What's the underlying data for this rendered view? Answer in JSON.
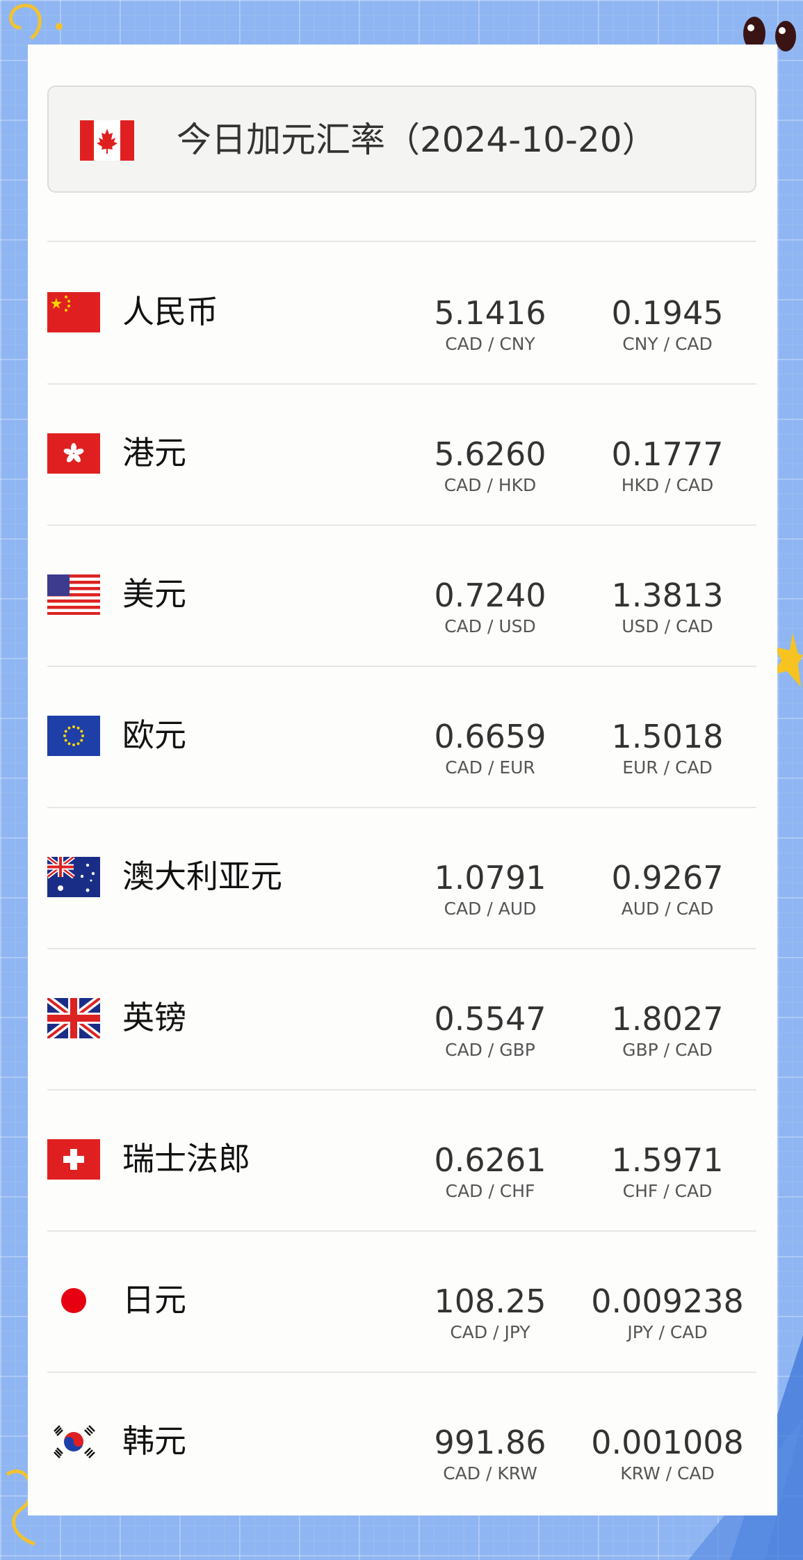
{
  "header": {
    "flag_icon": "canada-flag-icon",
    "title": "今日加元汇率（2024-10-20）"
  },
  "colors": {
    "background": "#8fb6f2",
    "card": "#fdfdfb",
    "flag_red": "#e02020"
  },
  "rates": [
    {
      "flag_icon": "china-flag-icon",
      "name": "人民币",
      "value_a": "5.1416",
      "pair_a": "CAD / CNY",
      "value_b": "0.1945",
      "pair_b": "CNY / CAD"
    },
    {
      "flag_icon": "hong-kong-flag-icon",
      "name": "港元",
      "value_a": "5.6260",
      "pair_a": "CAD / HKD",
      "value_b": "0.1777",
      "pair_b": "HKD / CAD"
    },
    {
      "flag_icon": "usa-flag-icon",
      "name": "美元",
      "value_a": "0.7240",
      "pair_a": "CAD / USD",
      "value_b": "1.3813",
      "pair_b": "USD / CAD"
    },
    {
      "flag_icon": "eu-flag-icon",
      "name": "欧元",
      "value_a": "0.6659",
      "pair_a": "CAD / EUR",
      "value_b": "1.5018",
      "pair_b": "EUR / CAD"
    },
    {
      "flag_icon": "australia-flag-icon",
      "name": "澳大利亚元",
      "value_a": "1.0791",
      "pair_a": "CAD / AUD",
      "value_b": "0.9267",
      "pair_b": "AUD / CAD"
    },
    {
      "flag_icon": "uk-flag-icon",
      "name": "英镑",
      "value_a": "0.5547",
      "pair_a": "CAD / GBP",
      "value_b": "1.8027",
      "pair_b": "GBP / CAD"
    },
    {
      "flag_icon": "switzerland-flag-icon",
      "name": "瑞士法郎",
      "value_a": "0.6261",
      "pair_a": "CAD / CHF",
      "value_b": "1.5971",
      "pair_b": "CHF / CAD"
    },
    {
      "flag_icon": "japan-flag-icon",
      "name": "日元",
      "value_a": "108.25",
      "pair_a": "CAD / JPY",
      "value_b": "0.009238",
      "pair_b": "JPY / CAD"
    },
    {
      "flag_icon": "south-korea-flag-icon",
      "name": "韩元",
      "value_a": "991.86",
      "pair_a": "CAD / KRW",
      "value_b": "0.001008",
      "pair_b": "KRW / CAD"
    }
  ]
}
